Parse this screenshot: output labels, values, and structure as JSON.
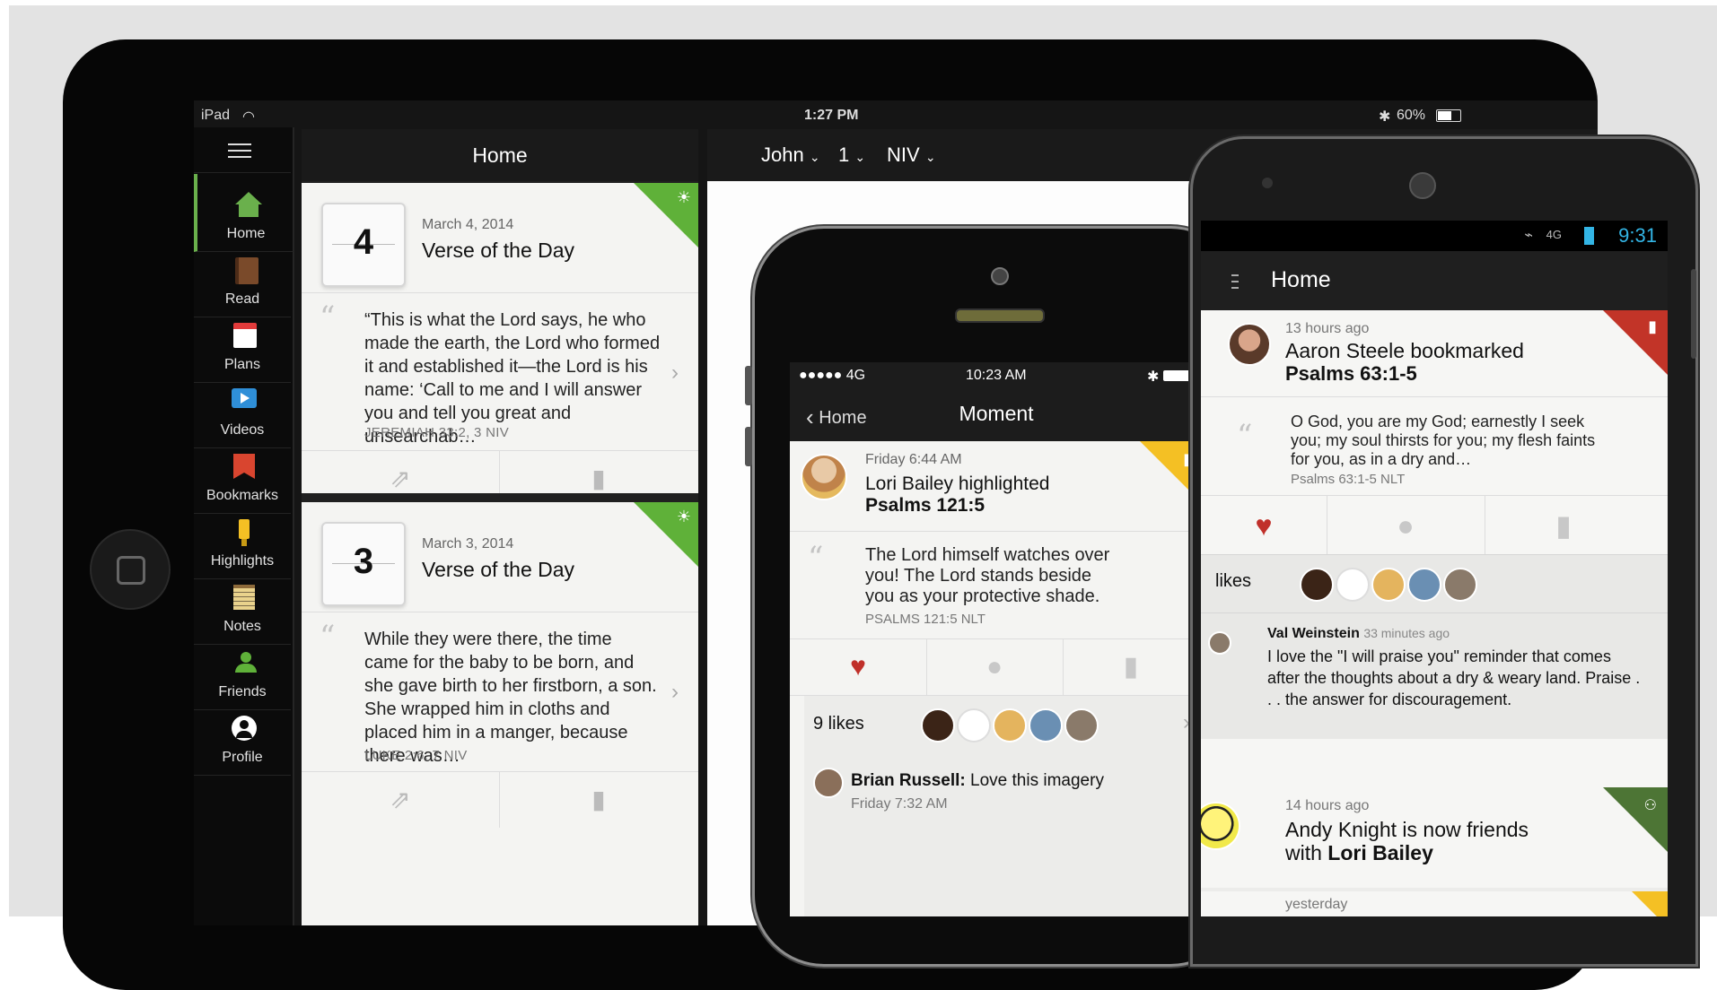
{
  "ipad": {
    "status": {
      "device": "iPad",
      "time": "1:27 PM",
      "battery": "60%"
    },
    "sidebar": [
      {
        "label": "Home",
        "icon": "home-icon",
        "color": "#6ab04c"
      },
      {
        "label": "Read",
        "icon": "book-icon",
        "color": "#7a4a2a"
      },
      {
        "label": "Plans",
        "icon": "calendar-icon",
        "color": "#e23b3b"
      },
      {
        "label": "Videos",
        "icon": "video-icon",
        "color": "#2f8fd8"
      },
      {
        "label": "Bookmarks",
        "icon": "bookmark-icon",
        "color": "#d9452f"
      },
      {
        "label": "Highlights",
        "icon": "highlighter-icon",
        "color": "#f4c024"
      },
      {
        "label": "Notes",
        "icon": "notes-icon",
        "color": "#e9d28c"
      },
      {
        "label": "Friends",
        "icon": "friends-icon",
        "color": "#5fb139"
      },
      {
        "label": "Profile",
        "icon": "profile-icon",
        "color": "#ffffff"
      }
    ],
    "home": {
      "title": "Home",
      "cards": [
        {
          "day": "4",
          "date": "March 4, 2014",
          "title": "Verse of the Day",
          "verse": "“This is what the Lord says, he who made the earth, the Lord who formed it and established it—the Lord is his name: ‘Call to me and I will answer you and tell you great and unsearchab…",
          "ref": "JEREMIAH 33:2, 3 NIV"
        },
        {
          "day": "3",
          "date": "March 3, 2014",
          "title": "Verse of the Day",
          "verse": "While they were there, the time came for the baby to be born, and she gave birth to her firstborn, a son. She wrapped him in cloths and placed him in a manger, because there was…",
          "ref": "LUKE 2:6, 7 NIV"
        }
      ]
    },
    "reader": {
      "book": "John",
      "chapter": "1",
      "version": "NIV"
    }
  },
  "iphone": {
    "status": {
      "carrier": "●●●●● 4G",
      "time": "10:23 AM"
    },
    "nav": {
      "back": "Home",
      "title": "Moment"
    },
    "moment": {
      "time": "Friday 6:44 AM",
      "actor": "Lori Bailey highlighted",
      "passage": "Psalms 121:5",
      "verse": "The Lord himself watches over you! The Lord stands beside you as your protective shade.",
      "ref": "PSALMS 121:5 NLT"
    },
    "likes": "9 likes",
    "comment": {
      "author": "Brian Russell:",
      "text": "Love this imagery",
      "time": "Friday 7:32 AM"
    }
  },
  "android": {
    "status": {
      "net": "4G",
      "time": "9:31"
    },
    "title": "Home",
    "bookmark": {
      "time": "13 hours ago",
      "actor": "Aaron Steele bookmarked",
      "passage": "Psalms 63:1-5",
      "verse": "O God, you are my God; earnestly I seek you; my soul thirsts for you; my flesh faints for you, as in a dry and…",
      "ref": "Psalms 63:1-5 NLT"
    },
    "likes": "likes",
    "comment": {
      "author": "Val Weinstein",
      "time": "33 minutes ago",
      "text": "I love the \"I will praise you\" reminder that comes after the thoughts about a dry & weary land.  Praise . . . the answer for discouragement."
    },
    "friend": {
      "time": "14 hours ago",
      "line1": "Andy Knight is now friends",
      "line2_prefix": "with ",
      "line2_name": "Lori Bailey"
    },
    "next_time": "yesterday"
  }
}
